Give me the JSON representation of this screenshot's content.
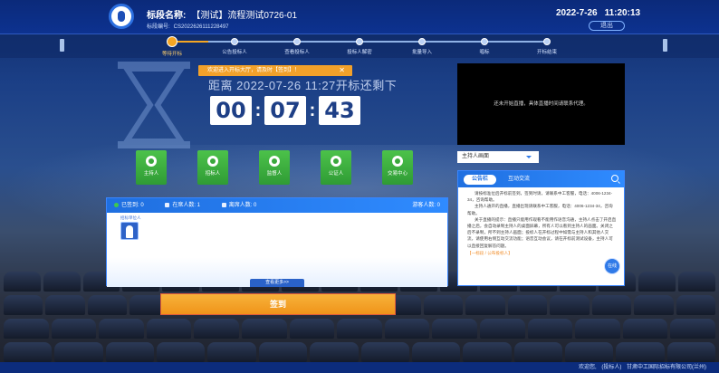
{
  "header": {
    "title_label": "标段名称:",
    "title_value": "【测试】流程测试0726-01",
    "code_label": "标段编号:",
    "code_value": "CS2022626111228497",
    "date": "2022-7-26",
    "time": "11:20:13",
    "exit_label": "退出"
  },
  "steps": [
    {
      "label": "等待开标",
      "active": true
    },
    {
      "label": "公告投标人"
    },
    {
      "label": "查看投标人"
    },
    {
      "label": "投标人解密"
    },
    {
      "label": "批量导入"
    },
    {
      "label": "唱标"
    },
    {
      "label": "开标结束"
    }
  ],
  "notice": {
    "text": "欢迎进入开标大厅，请及时【签到】！",
    "close": "✕"
  },
  "countdown": {
    "text": "距离 2022-07-26 11:27开标还剩下",
    "hours": "00",
    "minutes": "07",
    "seconds": "43"
  },
  "roles": [
    {
      "label": "主持人",
      "icon": "host-icon"
    },
    {
      "label": "招标人",
      "icon": "tenderee-icon"
    },
    {
      "label": "监督人",
      "icon": "supervisor-icon"
    },
    {
      "label": "公证人",
      "icon": "notary-icon"
    },
    {
      "label": "交易中心",
      "icon": "trade-center-icon"
    }
  ],
  "attendance": {
    "signed": "已签到: 0",
    "online": "在席人数: 1",
    "offline": "离席人数: 0",
    "visitors": "游客人数: 0",
    "person_name": "招标单位人",
    "more_label": "查看更多>>"
  },
  "sign_button": "签到",
  "video": {
    "status": "还未开始直播，具体直播时间请联系代理。"
  },
  "host_select": {
    "value": "主持人画面"
  },
  "announcement": {
    "tab_active": "公告栏",
    "tab_other": "互动交流",
    "paragraphs": [
      "请按标准位后开标前签到，签到时请，请联系中工客服，电话：4006-1234-34，咨询帮助。",
      "主持人通开的直播，直播出现请联系中工客服，电话：4006-1234-34，咨询帮助。",
      "关于直播的提示：直播只能用作观看不能用作语音沟通，主持人点击了开启直播之后，会自动录制主持人的桌面屏幕，所有人可以看到主持人的画面。关闭之后不录制，所不到主持人画面；投标人在开标过程中如需与主持人和其他人交流，请使用右侧互动交流功能；语音互动会议，请在开标前测试设备，主持人可以直接回复解答问题。"
    ],
    "more": "【一标段 / 公布投标人】",
    "fab_label": "在线"
  },
  "footer": {
    "welcome": "欢迎您,",
    "role": "(投标人)",
    "company": "甘肃中工国际招标有限公司(兰州)"
  }
}
